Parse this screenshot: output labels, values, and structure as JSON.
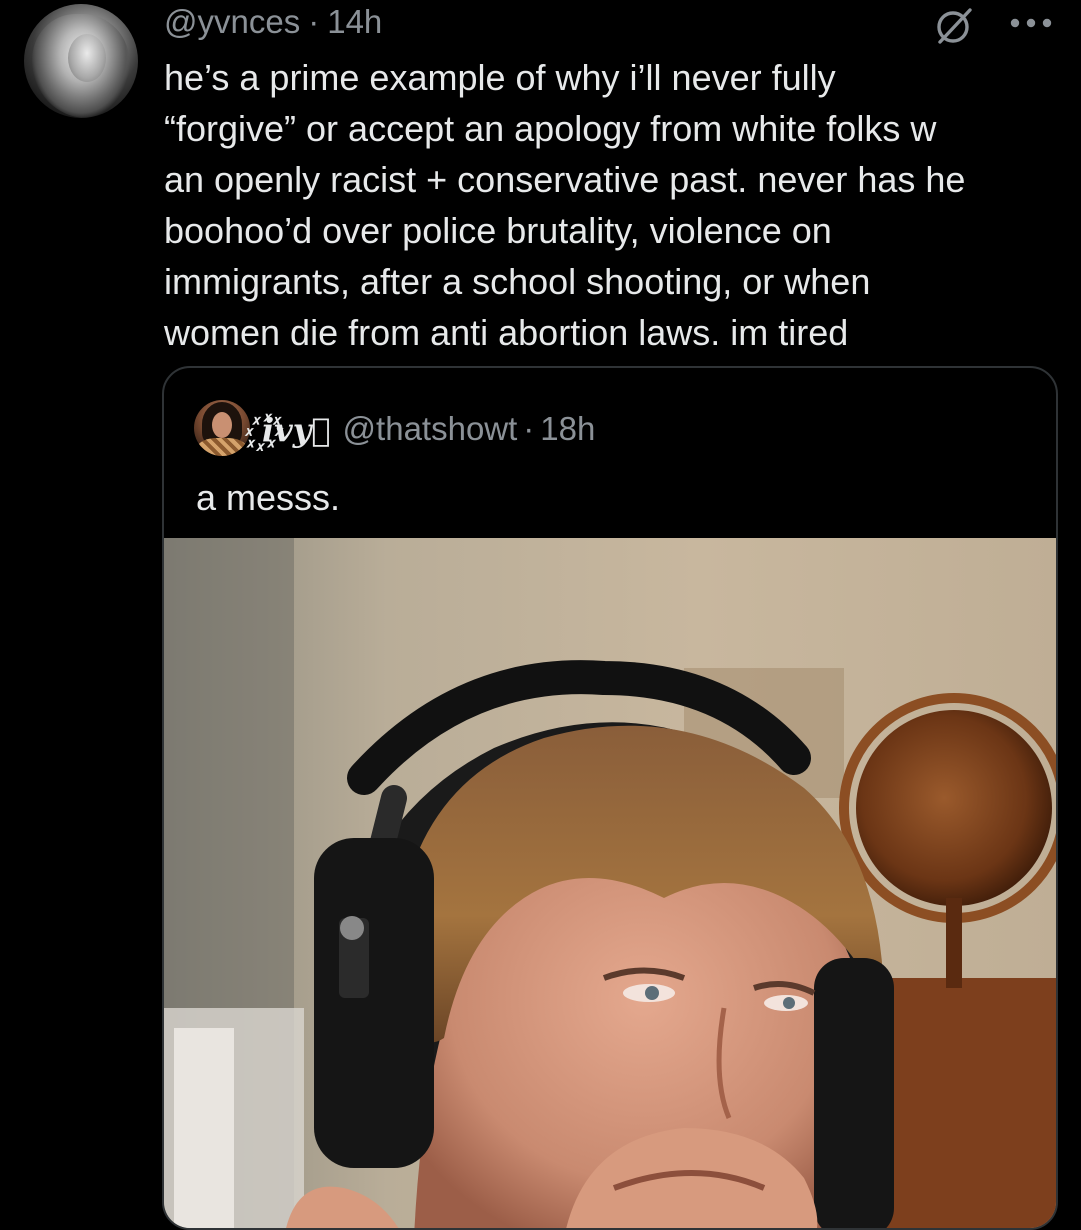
{
  "tweet": {
    "handle": "@yvnces",
    "separator": "·",
    "time": "14h",
    "text": "he’s a prime example of why i’ll never fully\n“forgive” or accept an apology from white folks w\nan openly racist + conservative past. never has he\nboohoo’d over police brutality, violence on\nimmigrants, after a school shooting, or when\nwomen die from anti abortion laws. im tired",
    "icons": {
      "avatar": "user-avatar",
      "grok": "grok-icon",
      "more": "more-options-icon"
    }
  },
  "quote": {
    "display_name": "꙰𝒊𝒗𝒚꙰",
    "handle": "@thatshowt",
    "separator": "·",
    "time": "18h",
    "text": "a messs.",
    "media_alt": "photo",
    "icons": {
      "avatar": "quoted-user-avatar"
    }
  },
  "colors": {
    "background": "#000000",
    "text": "#e7e9ea",
    "muted": "#8b9197",
    "border": "#2f3336"
  }
}
